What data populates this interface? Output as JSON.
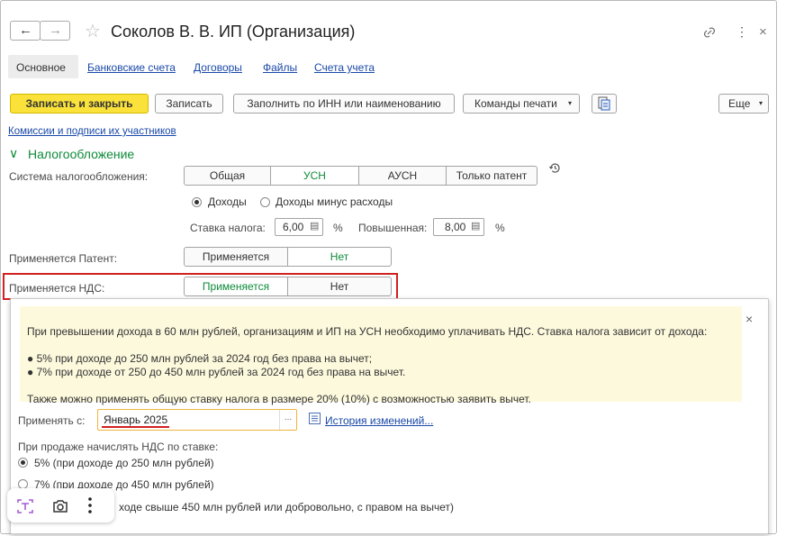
{
  "window": {
    "title": "Соколов В. В. ИП (Организация)",
    "nav_back": "←",
    "nav_forward": "→",
    "star": "☆",
    "link_icon": "link-icon",
    "more_icon": "⋮",
    "close": "×"
  },
  "tabs": [
    {
      "label": "Основное"
    },
    {
      "label": "Банковские счета"
    },
    {
      "label": "Договоры"
    },
    {
      "label": "Файлы"
    },
    {
      "label": "Счета учета"
    }
  ],
  "toolbar": {
    "save_close": "Записать и закрыть",
    "save": "Записать",
    "fill_inn": "Заполнить по ИНН или наименованию",
    "print_cmds": "Команды печати",
    "more": "Еще"
  },
  "commissions_link": "Комиссии и подписи их участников",
  "taxation": {
    "section_title": "Налогообложение",
    "system_label": "Система налогообложения:",
    "system_options": [
      "Общая",
      "УСН",
      "АУСН",
      "Только патент"
    ],
    "selected_system": "УСН",
    "income_options": [
      "Доходы",
      "Доходы минус расходы"
    ],
    "rate_label": "Ставка налога:",
    "rate_value": "6,00",
    "percent": "%",
    "increased_label": "Повышенная:",
    "increased_value": "8,00"
  },
  "patent": {
    "label": "Применяется Патент:",
    "options": [
      "Применяется",
      "Нет"
    ]
  },
  "vat": {
    "label": "Применяется НДС:",
    "options": [
      "Применяется",
      "Нет"
    ]
  },
  "popup": {
    "close": "×",
    "line1": "При превышении дохода в 60 млн рублей, организациям и ИП на УСН необходимо уплачивать НДС. Ставка налога зависит от дохода:",
    "line2": "● 5% при доходе до 250 млн рублей за 2024 год без права на вычет;",
    "line3": "● 7% при доходе от 250 до 450 млн рублей за 2024 год без права на вычет.",
    "line4": "Также можно применять общую ставку налога в размере 20% (10%) с возможностью заявить вычет.",
    "apply_from_label": "Применять с:",
    "apply_from_value": "Январь 2025",
    "dots": "...",
    "history_link": "История изменений...",
    "sale_rate_label": "При продаже начислять НДС по ставке:",
    "rate_options": [
      "5% (при доходе до 250 млн рублей)",
      "7% (при доходе до 450 млн рублей)",
      "20% (при доходе свыше 450 млн рублей или добровольно, с правом на вычет)"
    ],
    "rate_option3_visible": "ходе свыше 450 млн рублей или добровольно, с правом на вычет)"
  },
  "overlay_toolbar": {
    "icons": [
      "text-recognition-icon",
      "screenshot-icon",
      "more-vertical-icon"
    ]
  },
  "colors": {
    "accent_green": "#0e8a3a",
    "primary_button": "#fbe23a",
    "highlight_red": "#d12121",
    "link_blue": "#1a49a8"
  }
}
